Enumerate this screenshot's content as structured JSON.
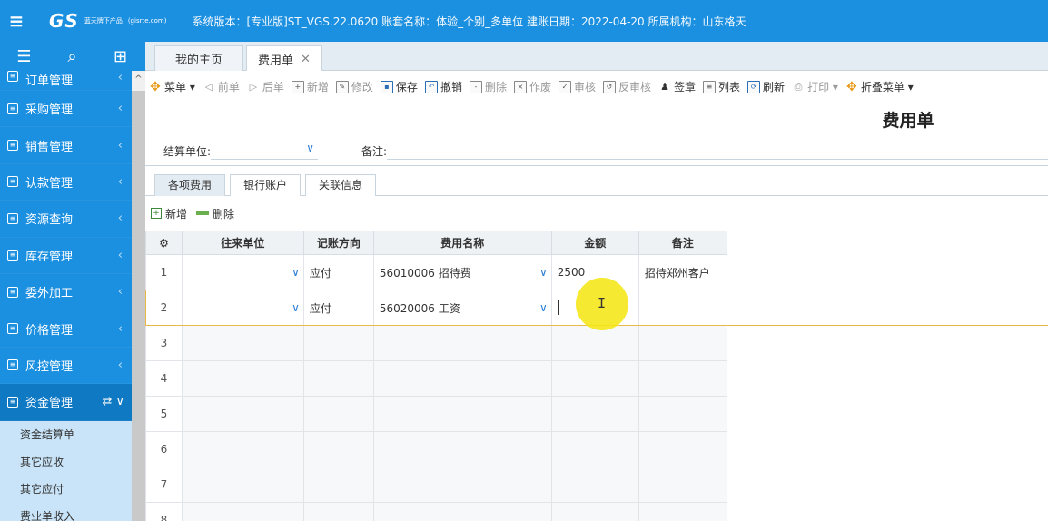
{
  "topbar": {
    "logo": "GS",
    "logo_sub": "蓝天牌下产品",
    "logo_site": "(gisrte.com)",
    "sysinfo": "系统版本：[专业版]ST_VGS.22.0620    账套名称：体验_个别_多单位    建账日期：2022-04-20    所属机构：山东格天"
  },
  "sidebar": {
    "groups": [
      {
        "label": "订单管理"
      },
      {
        "label": "采购管理"
      },
      {
        "label": "销售管理"
      },
      {
        "label": "认款管理"
      },
      {
        "label": "资源查询"
      },
      {
        "label": "库存管理"
      },
      {
        "label": "委外加工"
      },
      {
        "label": "价格管理"
      },
      {
        "label": "风控管理"
      },
      {
        "label": "资金管理"
      }
    ],
    "sub_items": [
      "资金结算单",
      "其它应收",
      "其它应付",
      "费业单收入"
    ]
  },
  "tabs": [
    {
      "label": "我的主页"
    },
    {
      "label": "费用单"
    }
  ],
  "toolbar": {
    "menu": "菜单",
    "prev": "前单",
    "next": "后单",
    "add": "新增",
    "edit": "修改",
    "save": "保存",
    "undo": "撤销",
    "delete": "删除",
    "void": "作废",
    "audit": "审核",
    "unaudit": "反审核",
    "sign": "签章",
    "list": "列表",
    "refresh": "刷新",
    "print": "打印",
    "fold": "折叠菜单"
  },
  "form": {
    "title": "费用单",
    "settle_label": "结算单位:",
    "remark_label": "备注:"
  },
  "subtabs": [
    "各项费用",
    "银行账户",
    "关联信息"
  ],
  "gridbar": {
    "add": "新增",
    "delete": "删除"
  },
  "grid": {
    "headers": [
      "往来单位",
      "记账方向",
      "费用名称",
      "金额",
      "备注"
    ],
    "rows": [
      {
        "no": "1",
        "party": "",
        "direction": "应付",
        "fee": "56010006 招待费",
        "amount": "2500",
        "remark": "招待郑州客户"
      },
      {
        "no": "2",
        "party": "",
        "direction": "应付",
        "fee": "56020006 工资",
        "amount": "",
        "remark": ""
      },
      {
        "no": "3"
      },
      {
        "no": "4"
      },
      {
        "no": "5"
      },
      {
        "no": "6"
      },
      {
        "no": "7"
      },
      {
        "no": "8"
      }
    ]
  }
}
